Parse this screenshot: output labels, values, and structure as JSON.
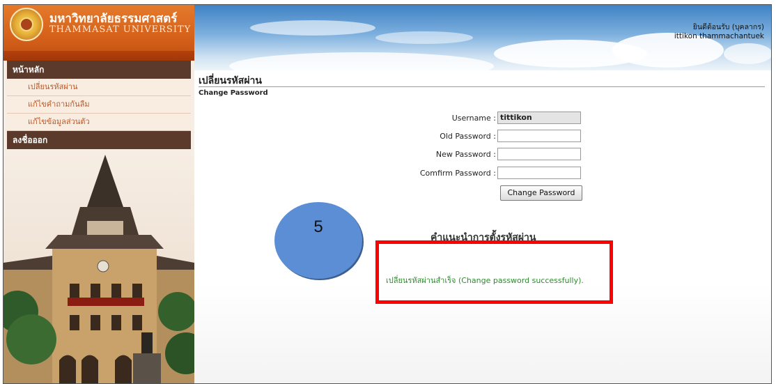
{
  "brand": {
    "thai": "มหาวิทยาลัยธรรมศาสตร์",
    "english": "THAMMASAT UNIVERSITY"
  },
  "menu": {
    "home": "หน้าหลัก",
    "items": [
      "เปลี่ยนรหัสผ่าน",
      "แก้ไขคำถามกันลืม",
      "แก้ไขข้อมูลส่วนตัว"
    ],
    "logout": "ลงชื่อออก"
  },
  "header": {
    "welcome": "ยินดีต้อนรับ (บุคลากร)",
    "user": "ittikon thammachantuek"
  },
  "page": {
    "title": "เปลี่ยนรหัสผ่าน",
    "subtitle": "Change Password"
  },
  "form": {
    "username_label": "Username :",
    "username_value": "tittikon",
    "old_password_label": "Old Password :",
    "new_password_label": "New Password :",
    "confirm_password_label": "Comfirm Password :",
    "submit_label": "Change Password"
  },
  "tips_title": "คำแนะนำการตั้งรหัสผ่าน",
  "success_message": "เปลี่ยนรหัสผ่านสำเร็จ (Change password successfully).",
  "annotation": {
    "step_number": "5"
  },
  "colors": {
    "brand_orange": "#d4601a",
    "menu_brown": "#5b3a2b",
    "success_green": "#2e8b2e",
    "highlight_red": "#ff0000",
    "step_blue": "#5b8ed4"
  }
}
